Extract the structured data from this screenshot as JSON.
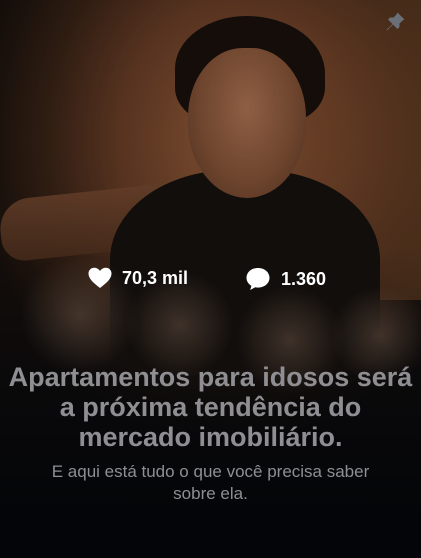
{
  "post": {
    "likes": "70,3 mil",
    "comments": "1.360",
    "headline": "Apartamentos para idosos será a próxima tendência do mercado imobiliário.",
    "subheadline": "E aqui está tudo o que você precisa saber sobre ela."
  },
  "icons": {
    "pin": "pin-icon",
    "like": "heart-icon",
    "comment": "comment-bubble-icon"
  },
  "colors": {
    "background_dark": "#05070b",
    "photo_warm": "#a0643f",
    "text_muted": "#8f8f93",
    "stat_text": "#ffffff"
  }
}
